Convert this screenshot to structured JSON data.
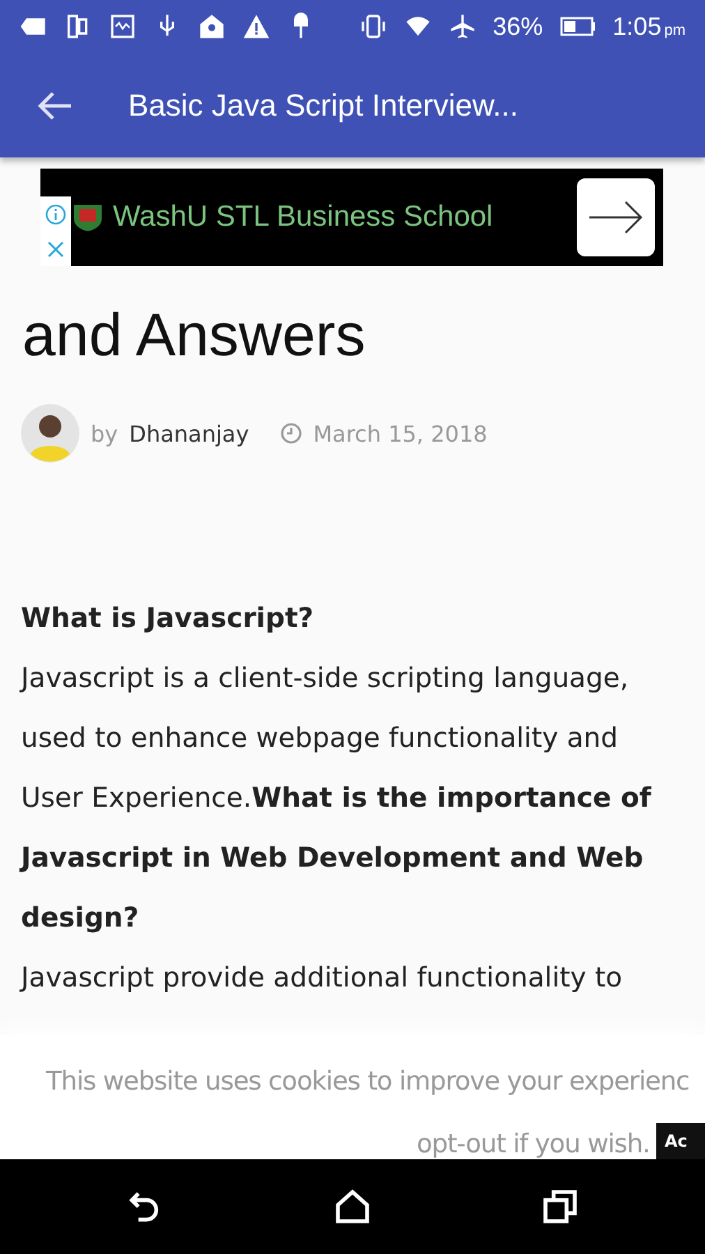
{
  "status_bar": {
    "battery": "36%",
    "time": "1:05",
    "time_suffix": "pm"
  },
  "app_bar": {
    "title": "Basic Java Script Interview..."
  },
  "ad": {
    "text": "WashU STL Business School"
  },
  "article": {
    "heading": "and Answers",
    "author_prefix": "by",
    "author": "Dhananjay",
    "date": "March 15, 2018",
    "paragraphs": [
      {
        "kind": "question",
        "text": "What is Javascript?"
      },
      {
        "kind": "answer",
        "text": "Javascript is a client-side scripting language, used to enhance webpage functionality and User Experience.**What is the importance of Javascript in Web Development and Web design?**"
      },
      {
        "kind": "answer",
        "text": "Javascript provide additional functionality to"
      }
    ]
  },
  "cookie_notice": {
    "line_1": "This website uses cookies to improve your experienc",
    "line_2": "opt-out if you wish.",
    "button": "Ac"
  }
}
